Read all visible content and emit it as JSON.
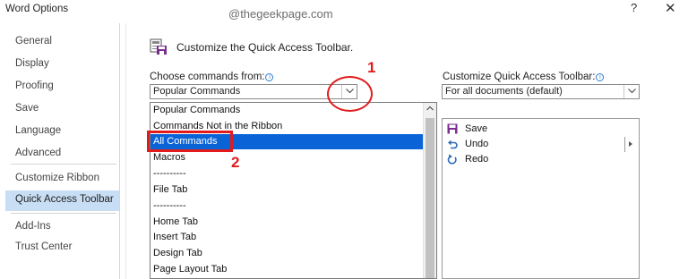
{
  "window": {
    "title": "Word Options",
    "watermark": "@thegeekpage.com",
    "help_label": "?",
    "close_label": "✕"
  },
  "sidebar": {
    "items": [
      {
        "label": "General"
      },
      {
        "label": "Display"
      },
      {
        "label": "Proofing"
      },
      {
        "label": "Save"
      },
      {
        "label": "Language"
      },
      {
        "label": "Advanced"
      },
      {
        "label": "Customize Ribbon"
      },
      {
        "label": "Quick Access Toolbar",
        "active": true
      },
      {
        "label": "Add-Ins"
      },
      {
        "label": "Trust Center"
      }
    ]
  },
  "main": {
    "heading": "Customize the Quick Access Toolbar.",
    "choose_label": "Choose commands from:",
    "choose_value": "Popular Commands",
    "customize_label": "Customize Quick Access Toolbar:",
    "customize_value": "For all documents (default)"
  },
  "dropdown": {
    "options": [
      "Popular Commands",
      "Commands Not in the Ribbon",
      "All Commands",
      "Macros",
      "----------",
      "File Tab",
      "----------",
      "Home Tab",
      "Insert Tab",
      "Design Tab",
      "Page Layout Tab"
    ],
    "selected_index": 2
  },
  "toolbar_list": {
    "items": [
      {
        "label": "Save",
        "icon": "save-icon"
      },
      {
        "label": "Undo",
        "icon": "undo-icon"
      },
      {
        "label": "Redo",
        "icon": "redo-icon"
      }
    ]
  },
  "annotations": {
    "step1": "1",
    "step2": "2"
  },
  "colors": {
    "selection": "#0a64d8",
    "nav_active": "#c8def4",
    "annotation": "#e21b1b",
    "info_icon": "#2b7cd3"
  }
}
